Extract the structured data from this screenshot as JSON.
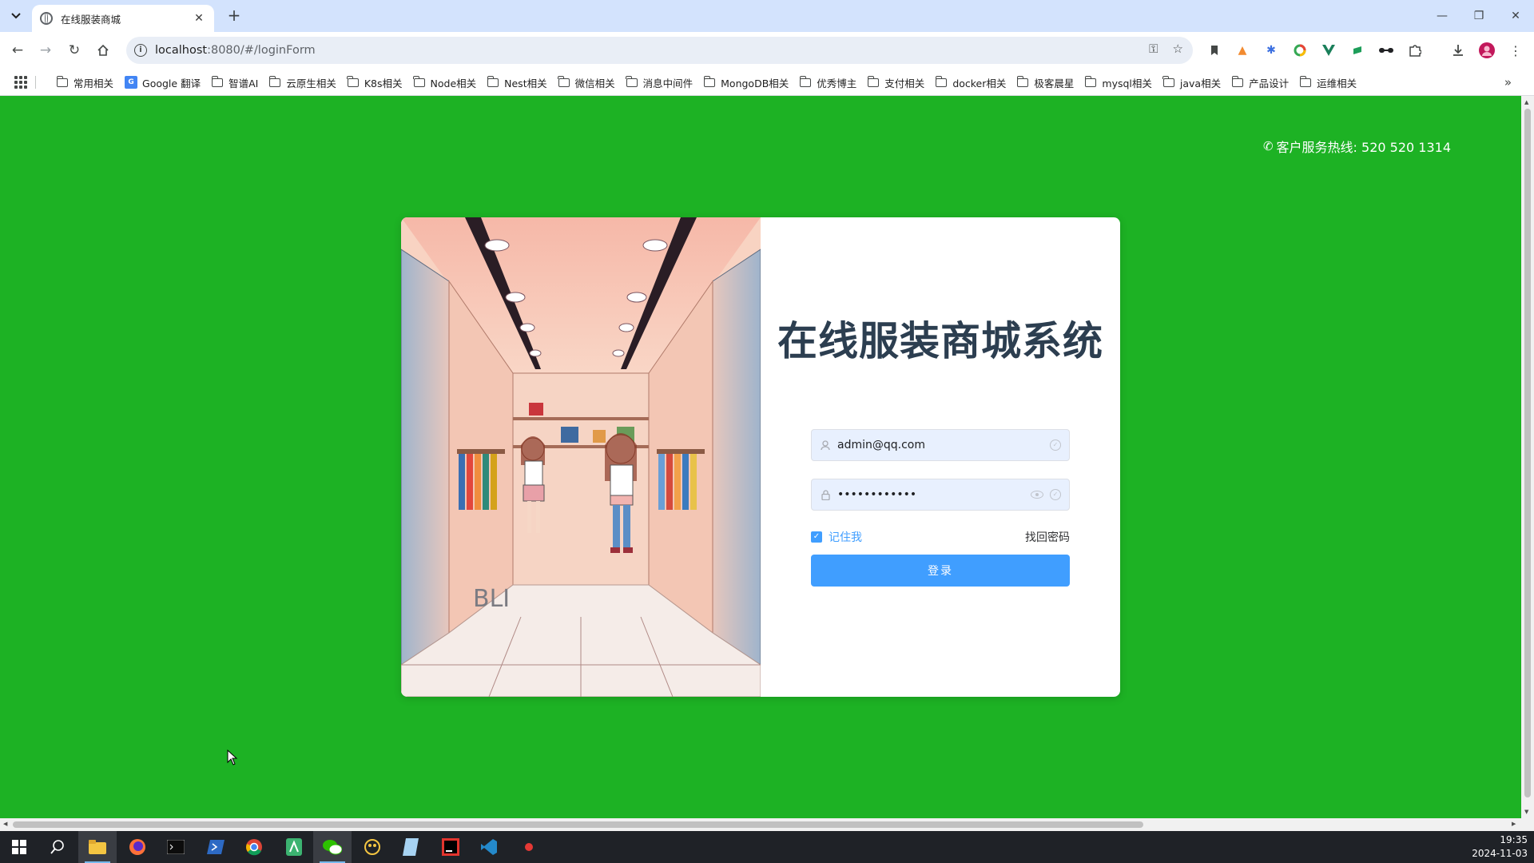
{
  "browser": {
    "tab_title": "在线服装商城",
    "url_host": "localhost",
    "url_path": ":8080/#/loginForm",
    "bookmarks": [
      "常用相关",
      "Google 翻译",
      "智谱AI",
      "云原生相关",
      "K8s相关",
      "Node相关",
      "Nest相关",
      "微信相关",
      "消息中间件",
      "MongoDB相关",
      "优秀博主",
      "支付相关",
      "docker相关",
      "极客晨星",
      "mysql相关",
      "java相关",
      "产品设计",
      "运维相关"
    ]
  },
  "page": {
    "hotline_label": "客户服务热线: 520 520 1314",
    "title": "在线服装商城系统",
    "illustration_sign": "BLI",
    "login": {
      "username_value": "admin@qq.com",
      "password_value": "••••••••••••",
      "remember_label": "记住我",
      "remember_checked": true,
      "forgot_label": "找回密码",
      "submit_label": "登录"
    },
    "accent_color": "#409eff",
    "background_color": "#1db224"
  },
  "taskbar": {
    "apps": [
      "start-icon",
      "search-icon",
      "file-explorer-icon",
      "firefox-icon",
      "terminal-icon",
      "powershell-icon",
      "chrome-icon",
      "app-icon",
      "wechat-icon",
      "dragon-icon",
      "notes-icon",
      "jetbrains-icon",
      "vscode-icon",
      "recorder-icon"
    ],
    "time": "19:35",
    "date": "2024-11-03"
  }
}
